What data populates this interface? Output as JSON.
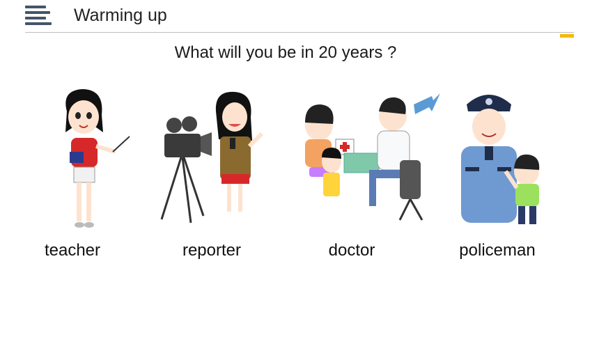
{
  "header": {
    "menu_icon": "menu-lines-icon",
    "title": "Warming up",
    "accent_color": "#f5b800",
    "icon_color": "#44546a"
  },
  "question": "What will you be in 20 years ?",
  "jobs": [
    {
      "label": "teacher",
      "image": "teacher-illustration"
    },
    {
      "label": "reporter",
      "image": "reporter-illustration"
    },
    {
      "label": "doctor",
      "image": "doctor-illustration"
    },
    {
      "label": "policeman",
      "image": "policeman-illustration"
    }
  ]
}
